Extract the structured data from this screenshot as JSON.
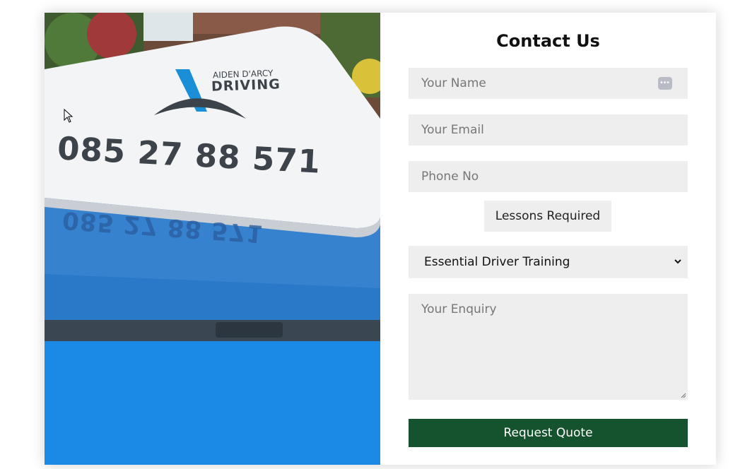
{
  "photo": {
    "sign_brand_top": "AIDEN D'ARCY",
    "sign_brand_main": "DRIVING",
    "sign_phone": "085 27 88 571",
    "colors": {
      "car_blue": "#1f86e0",
      "sign_white": "#f2f4f6",
      "logo_blue": "#1a8fd8"
    }
  },
  "form": {
    "title": "Contact Us",
    "name_placeholder": "Your Name",
    "email_placeholder": "Your Email",
    "phone_placeholder": "Phone No",
    "lessons_label": "Lessons Required",
    "lessons_selected": "Essential Driver Training",
    "enquiry_placeholder": "Your Enquiry",
    "submit_label": "Request Quote",
    "colors": {
      "field_bg": "#eeeeee",
      "submit_bg": "#14532d",
      "submit_text": "#ffffff"
    }
  }
}
